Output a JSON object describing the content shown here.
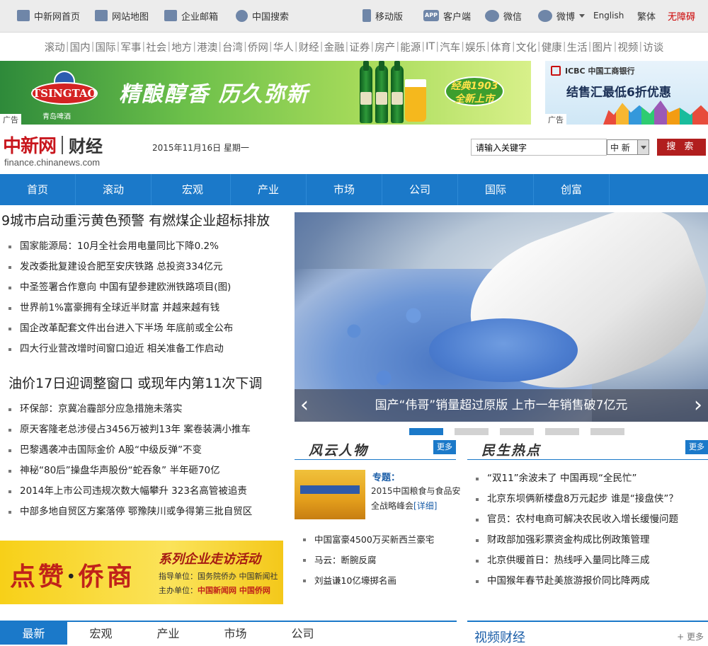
{
  "topbar": {
    "home": "中新网首页",
    "sitemap": "网站地图",
    "mail": "企业邮箱",
    "search": "中国搜索",
    "mobile": "移动版",
    "app_icon": "APP",
    "client": "客户端",
    "wechat": "微信",
    "weibo": "微博",
    "english": "English",
    "traditional": "繁体",
    "accessible": "无障碍"
  },
  "channels": [
    "滚动",
    "国内",
    "国际",
    "军事",
    "社会",
    "地方",
    "港澳",
    "台湾",
    "侨网",
    "华人",
    "财经",
    "金融",
    "证券",
    "房产",
    "能源",
    "IT",
    "汽车",
    "娱乐",
    "体育",
    "文化",
    "健康",
    "生活",
    "图片",
    "视频",
    "访谈"
  ],
  "ads": {
    "tsingtao_brand": "TSINGTAO",
    "tsingtao_cn": "青岛啤酒",
    "tsingtao_slogan": "精酿醇香  历久弥新",
    "tsingtao_badge": "经典1903 全新上市",
    "ad_label": "广告",
    "icbc_head": "ICBC 中国工商银行",
    "icbc_text": "结售汇最低6折优惠",
    "dz_big_1": "点赞",
    "dz_dot": "·",
    "dz_big_2": "侨商",
    "dz_title": "系列企业走访活动",
    "dz_guide": "指导单位：国务院侨办  中国新闻社",
    "dz_host_label": "主办单位：",
    "dz_host": "中国新闻网  中国侨网"
  },
  "header": {
    "logo": "中新网",
    "section": "财经",
    "domain": "finance.chinanews.com",
    "date": "2015年11月16日  星期一",
    "search_placeholder": "请输入关键字",
    "search_scope": "中 新",
    "search_button": "搜 索"
  },
  "nav": [
    "首页",
    "滚动",
    "宏观",
    "产业",
    "市场",
    "公司",
    "国际",
    "创富"
  ],
  "news1": {
    "headline": "9城市启动重污黄色预警 有燃煤企业超标排放",
    "items": [
      "国家能源局：10月全社会用电量同比下降0.2%",
      "发改委批复建设合肥至安庆铁路 总投资334亿元",
      "中圣签署合作意向 中国有望参建欧洲铁路项目(图)",
      "世界前1%富豪拥有全球近半财富 并越来越有钱",
      "国企改革配套文件出台进入下半场 年底前或全公布",
      "四大行业营改增时间窗口迫近 相关准备工作启动"
    ]
  },
  "news2": {
    "headline": "油价17日迎调整窗口 或现年内第11次下调",
    "items": [
      "环保部：京冀冶霾部分应急措施未落实",
      "原天客隆老总涉侵占3456万被判13年 案卷装满小推车",
      "巴黎遇袭冲击国际金价 A股“中级反弹”不变",
      "神秘“80后”操盘华声股份“蛇吞象” 半年砸70亿",
      "2014年上市公司违规次数大幅攀升 323名高管被追责",
      "中部多地自贸区方案落停 鄂豫陕川或争得第三批自贸区"
    ]
  },
  "hero": {
    "caption": "国产“伟哥”销量超过原版 上市一年销售破7亿元",
    "prev": "‹",
    "next": "›"
  },
  "fengyun": {
    "title": "风云人物",
    "more": "更多",
    "zt_label": "专题：",
    "zt_text": "2015中国粮食与食品安全战略峰会",
    "zt_link": "[详细]",
    "items": [
      "中国富豪4500万买新西兰豪宅",
      "马云：断腕反腐",
      "刘益谦10亿壕掷名画"
    ]
  },
  "minsheng": {
    "title": "民生热点",
    "more": "更多",
    "items": [
      "“双11”余波未了 中国再现“全民忙”",
      "北京东坝俩新楼盘8万元起步 谁是“接盘侠”？",
      "官员：农村电商可解决农民收入增长缓慢问题",
      "财政部加强彩票资金构成比例政策管理",
      "北京供暖首日：热线呼入量同比降三成",
      "中国猴年春节赴美旅游报价同比降两成"
    ]
  },
  "bottom_tabs": [
    "最新",
    "宏观",
    "产业",
    "市场",
    "公司"
  ],
  "video": {
    "title": "视频财经",
    "more": "+ 更多"
  }
}
